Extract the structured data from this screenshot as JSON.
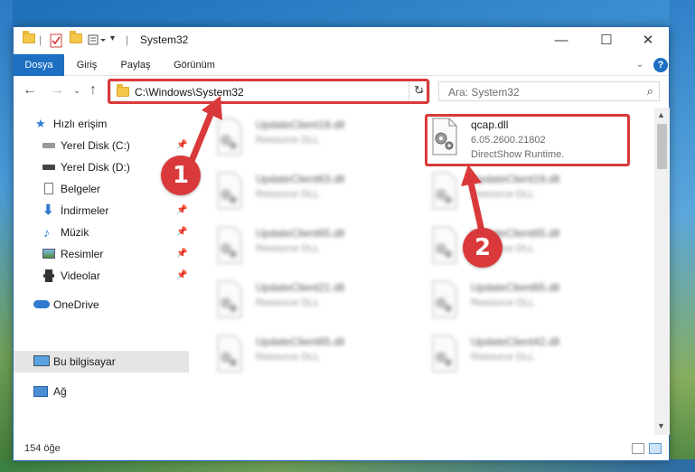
{
  "window": {
    "title": "System32",
    "controls": {
      "minimize": "—",
      "maximize": "☐",
      "close": "✕"
    }
  },
  "ribbon": {
    "tabs": [
      "Dosya",
      "Giriş",
      "Paylaş",
      "Görünüm"
    ],
    "help": "?"
  },
  "address": {
    "path": "C:\\Windows\\System32",
    "search_placeholder": "Ara: System32"
  },
  "sidebar": {
    "items": [
      {
        "label": "Hızlı erişim",
        "icon": "star-icon"
      },
      {
        "label": "Yerel Disk (C:)",
        "icon": "drive-icon",
        "pinned": true
      },
      {
        "label": "Yerel Disk (D:)",
        "icon": "drive-icon",
        "pinned": false
      },
      {
        "label": "Belgeler",
        "icon": "document-icon",
        "pinned": false
      },
      {
        "label": "İndirmeler",
        "icon": "download-icon",
        "pinned": true
      },
      {
        "label": "Müzik",
        "icon": "music-icon",
        "pinned": true
      },
      {
        "label": "Resimler",
        "icon": "pictures-icon",
        "pinned": true
      },
      {
        "label": "Videolar",
        "icon": "video-icon",
        "pinned": true
      },
      {
        "label": "OneDrive",
        "icon": "cloud-icon"
      },
      {
        "label": "Bu bilgisayar",
        "icon": "computer-icon",
        "selected": true
      },
      {
        "label": "Ağ",
        "icon": "network-icon"
      }
    ]
  },
  "files": {
    "highlighted": {
      "name": "qcap.dll",
      "version": "6.05.2600.21802",
      "description": "DirectShow Runtime."
    },
    "left_column": [
      {
        "name": "UpdateClient19.dll",
        "desc": "Resource DLL"
      },
      {
        "name": "UpdateClient63.dll",
        "desc": "Resource DLL"
      },
      {
        "name": "UpdateClient65.dll",
        "desc": "Resource DLL"
      },
      {
        "name": "UpdateClient21.dll",
        "desc": "Resource DLL"
      },
      {
        "name": "UpdateClient65.dll",
        "desc": "Resource DLL"
      }
    ],
    "right_column": [
      {
        "name": "UpdateClient19.dll",
        "desc": "Resource DLL"
      },
      {
        "name": "UpdateClient65.dll",
        "desc": "Resource DLL"
      },
      {
        "name": "UpdateClient65.dll",
        "desc": "Resource DLL"
      },
      {
        "name": "UpdateClient42.dll",
        "desc": "Resource DLL"
      }
    ]
  },
  "status": {
    "item_count": "154 öğe"
  },
  "annotations": {
    "step1": "1",
    "step2": "2",
    "color": "#d9393a"
  }
}
